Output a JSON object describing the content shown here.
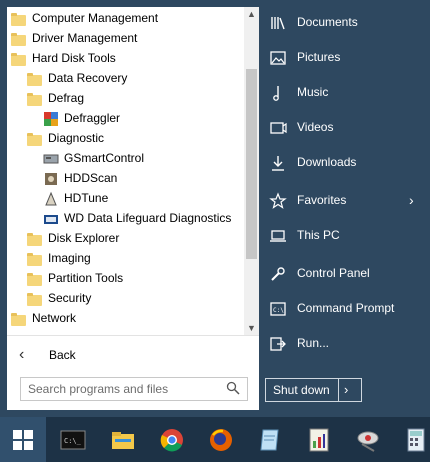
{
  "tree": [
    {
      "label": "Computer Management",
      "indent": 0,
      "icon": "folder-icon"
    },
    {
      "label": "Driver Management",
      "indent": 0,
      "icon": "folder-icon"
    },
    {
      "label": "Hard Disk Tools",
      "indent": 0,
      "icon": "folder-icon"
    },
    {
      "label": "Data Recovery",
      "indent": 1,
      "icon": "folder-icon"
    },
    {
      "label": "Defrag",
      "indent": 1,
      "icon": "folder-icon"
    },
    {
      "label": "Defraggler",
      "indent": 2,
      "icon": "defraggler-icon"
    },
    {
      "label": "Diagnostic",
      "indent": 1,
      "icon": "folder-icon"
    },
    {
      "label": "GSmartControl",
      "indent": 2,
      "icon": "gsmartcontrol-icon"
    },
    {
      "label": "HDDScan",
      "indent": 2,
      "icon": "hddscan-icon"
    },
    {
      "label": "HDTune",
      "indent": 2,
      "icon": "hdtune-icon"
    },
    {
      "label": "WD Data Lifeguard Diagnostics",
      "indent": 2,
      "icon": "wd-lifeguard-icon"
    },
    {
      "label": "Disk Explorer",
      "indent": 1,
      "icon": "folder-icon"
    },
    {
      "label": "Imaging",
      "indent": 1,
      "icon": "folder-icon"
    },
    {
      "label": "Partition Tools",
      "indent": 1,
      "icon": "folder-icon"
    },
    {
      "label": "Security",
      "indent": 1,
      "icon": "folder-icon"
    },
    {
      "label": "Network",
      "indent": 0,
      "icon": "folder-icon"
    }
  ],
  "back_label": "Back",
  "search": {
    "placeholder": "Search programs and files",
    "value": ""
  },
  "right_items": [
    {
      "label": "Documents",
      "icon": "documents-icon"
    },
    {
      "label": "Pictures",
      "icon": "pictures-icon"
    },
    {
      "label": "Music",
      "icon": "music-icon"
    },
    {
      "label": "Videos",
      "icon": "videos-icon"
    },
    {
      "label": "Downloads",
      "icon": "downloads-icon"
    },
    {
      "label": "Favorites",
      "icon": "star-icon",
      "submenu": true
    },
    {
      "label": "This PC",
      "icon": "laptop-icon"
    },
    {
      "label": "Control Panel",
      "icon": "wrench-icon"
    },
    {
      "label": "Command Prompt",
      "icon": "command-prompt-icon"
    },
    {
      "label": "Run...",
      "icon": "run-icon"
    }
  ],
  "shutdown_label": "Shut down",
  "taskbar": [
    {
      "name": "windows-start-icon"
    },
    {
      "name": "command-prompt-icon"
    },
    {
      "name": "file-explorer-icon"
    },
    {
      "name": "chrome-icon"
    },
    {
      "name": "firefox-icon"
    },
    {
      "name": "notepad-icon"
    },
    {
      "name": "spreadsheet-icon"
    },
    {
      "name": "disk-tool-icon"
    },
    {
      "name": "calculator-icon"
    }
  ],
  "colors": {
    "menu_bg": "#2e4860",
    "taskbar_bg": "#1d3246",
    "folder": "#f5d67a"
  }
}
